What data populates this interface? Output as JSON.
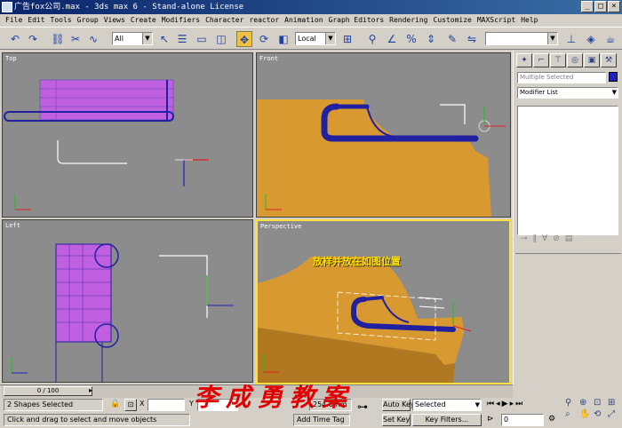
{
  "window": {
    "title": "广告fox公司.max - 3ds max 6 - Stand-alone License",
    "min": "_",
    "max": "□",
    "close": "×"
  },
  "menu": [
    "File",
    "Edit",
    "Tools",
    "Group",
    "Views",
    "Create",
    "Modifiers",
    "Character",
    "reactor",
    "Animation",
    "Graph Editors",
    "Rendering",
    "Customize",
    "MAXScript",
    "Help"
  ],
  "toolbar": {
    "filter": "All",
    "coord": "Local"
  },
  "viewports": {
    "top": "Top",
    "front": "Front",
    "left": "Left",
    "persp": "Perspective"
  },
  "caption": "放样并放在如图位置",
  "command_panel": {
    "name_field": "Multiple Selected",
    "modifier_list": "Modifier List",
    "color": "#2020c0"
  },
  "timeline": {
    "frame": "0 / 100"
  },
  "status": {
    "selection": "2 Shapes Selected",
    "prompt": "Click and drag to select and move objects",
    "x_label": "X",
    "y_label": "Y",
    "grid": "254.0mm",
    "add_time_tag": "Add Time Tag",
    "auto_key": "Auto Key",
    "set_key": "Set Key",
    "selected": "Selected",
    "key_filters": "Key Filters...",
    "frame_value": "0"
  },
  "watermark": "李成勇教案",
  "colors": {
    "viewport_bg": "#8c8c8c",
    "active_border": "#ffe040",
    "wood": "#d89a30",
    "tube": "#2020a0"
  }
}
